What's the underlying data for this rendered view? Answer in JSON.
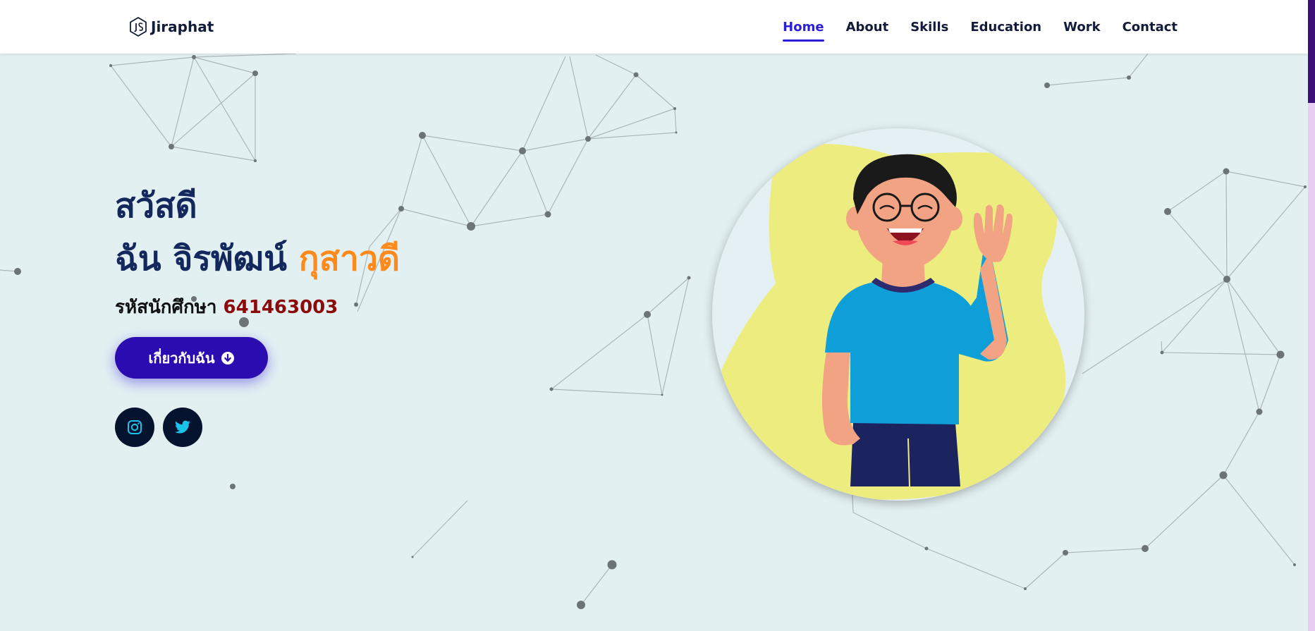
{
  "header": {
    "brand_name": "Jiraphat",
    "logo_icon": "nodejs-hex-icon",
    "nav": [
      {
        "label": "Home",
        "active": true
      },
      {
        "label": "About",
        "active": false
      },
      {
        "label": "Skills",
        "active": false
      },
      {
        "label": "Education",
        "active": false
      },
      {
        "label": "Work",
        "active": false
      },
      {
        "label": "Contact",
        "active": false
      }
    ]
  },
  "hero": {
    "greeting": "สวัสดี",
    "intro_prefix": "ฉัน จิรพัฒน์",
    "surname": "กุสาวดี",
    "student_id_label": "รหัสนักศึกษา",
    "student_id": "641463003",
    "about_button_label": "เกี่ยวกับฉัน",
    "about_button_icon": "arrow-down-circle-icon",
    "socials": [
      {
        "icon": "instagram-icon"
      },
      {
        "icon": "twitter-icon"
      }
    ],
    "illustration": "waving-boy-illustration"
  },
  "colors": {
    "background": "#e3f0f2",
    "accent_nav": "#2a1fd6",
    "heading": "#13285c",
    "surname": "#ff8a1c",
    "student_id": "#8b0a0a",
    "button": "#2b0cb0",
    "social_bg": "#06132e",
    "social_icon": "#19c3ec",
    "blob": "#eded7f"
  }
}
